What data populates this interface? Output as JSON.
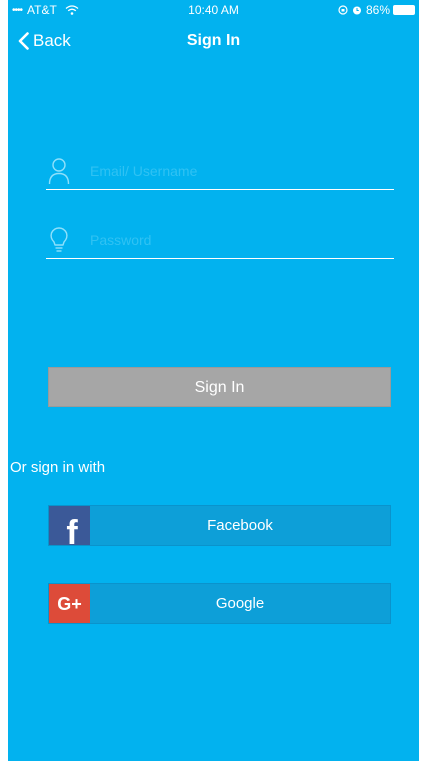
{
  "status_bar": {
    "signal": "••••",
    "carrier": "AT&T",
    "time": "10:40 AM",
    "battery": "86%",
    "icons": [
      "signal-dots-icon",
      "wifi-icon",
      "lock-rotation-icon",
      "alarm-icon",
      "battery-icon"
    ]
  },
  "nav": {
    "back_label": "Back",
    "title": "Sign In"
  },
  "form": {
    "username": {
      "value": "",
      "placeholder": "Email/ Username",
      "icon": "user-icon"
    },
    "password": {
      "value": "",
      "placeholder": "Password",
      "icon": "lightbulb-icon"
    },
    "signin_label": "Sign In"
  },
  "social": {
    "prompt": "Or sign in with",
    "facebook_label": "Facebook",
    "google_label": "Google",
    "facebook_logo": "f",
    "google_logo": "G+"
  },
  "colors": {
    "background": "#02b2ef",
    "signin_button": "#a6a6a6",
    "social_button": "#0d9fd8",
    "facebook_brand": "#3b5998",
    "google_brand": "#dd4b39"
  }
}
